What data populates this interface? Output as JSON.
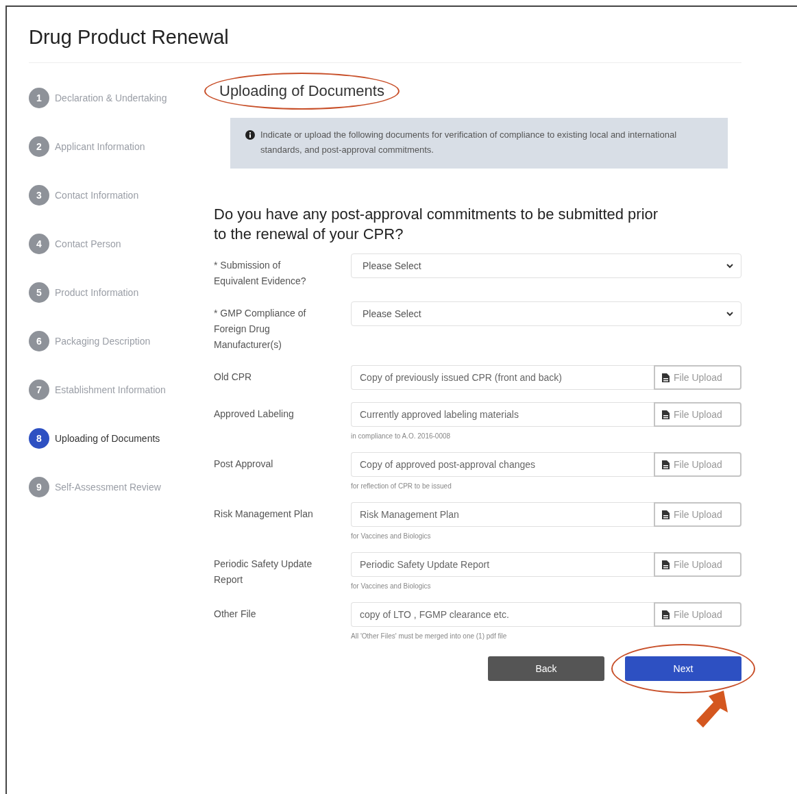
{
  "title": "Drug Product Renewal",
  "steps": [
    {
      "number": "1",
      "label": "Declaration & Undertaking",
      "selected": false
    },
    {
      "number": "2",
      "label": "Applicant Information",
      "selected": false
    },
    {
      "number": "3",
      "label": "Contact Information",
      "selected": false
    },
    {
      "number": "4",
      "label": "Contact Person",
      "selected": false
    },
    {
      "number": "5",
      "label": "Product Information",
      "selected": false
    },
    {
      "number": "6",
      "label": "Packaging Description",
      "selected": false
    },
    {
      "number": "7",
      "label": "Establishment Information",
      "selected": false
    },
    {
      "number": "8",
      "label": "Uploading of Documents",
      "selected": true
    },
    {
      "number": "9",
      "label": "Self-Assessment Review",
      "selected": false
    }
  ],
  "section_title": {
    "text": "Uploading of Documents",
    "highlighted": true
  },
  "notice": "Indicate or upload the following documents for verification of compliance to existing local and international standards, and post-approval commitments.",
  "question": "Do you have any post-approval commitments to be submitted prior to the renewal of your CPR?",
  "selects": [
    {
      "label": "* Submission of Equivalent Evidence?",
      "value": "Please Select"
    },
    {
      "label": "* GMP Compliance of Foreign Drug Manufacturer(s)",
      "value": "Please Select"
    }
  ],
  "uploads": [
    {
      "label": "Old CPR",
      "placeholder": "Copy of previously issued CPR (front and back)",
      "button": "File Upload"
    },
    {
      "label": "Approved Labeling",
      "placeholder": "Currently approved labeling materials",
      "button": "File Upload",
      "hint": "in compliance to A.O. 2016-0008"
    },
    {
      "label": "Post Approval",
      "placeholder": "Copy of approved post-approval changes",
      "button": "File Upload",
      "hint": "for reflection of CPR to be issued"
    },
    {
      "label": "Risk Management Plan",
      "placeholder": "Risk Management Plan",
      "button": "File Upload",
      "hint": "for Vaccines and Biologics"
    },
    {
      "label": "Periodic Safety Update Report",
      "placeholder": "Periodic Safety Update Report",
      "button": "File Upload",
      "hint": "for Vaccines and Biologics"
    },
    {
      "label": "Other File",
      "placeholder": "copy of LTO , FGMP clearance etc.",
      "button": "File Upload",
      "hint": "All 'Other Files' must be merged into one (1) pdf file"
    }
  ],
  "buttons": [
    {
      "label": "Back",
      "kind": "secondary",
      "highlighted": false
    },
    {
      "label": "Next",
      "kind": "primary",
      "highlighted": true
    }
  ]
}
